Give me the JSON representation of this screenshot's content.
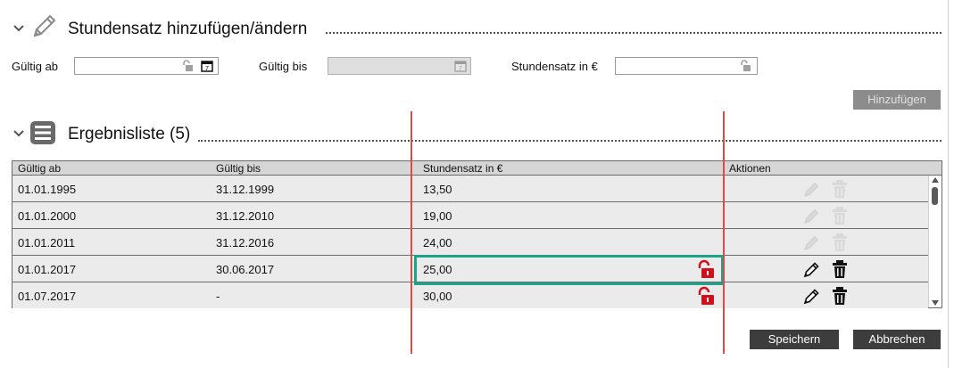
{
  "add_section": {
    "title": "Stundensatz hinzufügen/ändern",
    "fields": {
      "valid_from_label": "Gültig ab",
      "valid_from_value": "",
      "valid_to_label": "Gültig bis",
      "valid_to_value": "",
      "rate_label": "Stundensatz in €",
      "rate_value": ""
    },
    "add_button": "Hinzufügen"
  },
  "results": {
    "title": "Ergebnisliste (5)",
    "columns": [
      "Gültig ab",
      "Gültig bis",
      "Stundensatz in €",
      "Aktionen"
    ],
    "rows": [
      {
        "from": "01.01.1995",
        "to": "31.12.1999",
        "rate": "13,50",
        "actions_enabled": false,
        "unlocked": false
      },
      {
        "from": "01.01.2000",
        "to": "31.12.2010",
        "rate": "19,00",
        "actions_enabled": false,
        "unlocked": false
      },
      {
        "from": "01.01.2011",
        "to": "31.12.2016",
        "rate": "24,00",
        "actions_enabled": false,
        "unlocked": false
      },
      {
        "from": "01.01.2017",
        "to": "30.06.2017",
        "rate": "25,00",
        "actions_enabled": true,
        "unlocked": true,
        "highlighted": true
      },
      {
        "from": "01.07.2017",
        "to": "-",
        "rate": "30,00",
        "actions_enabled": true,
        "unlocked": true
      }
    ]
  },
  "footer": {
    "save_button": "Speichern",
    "cancel_button": "Abbrechen"
  },
  "colors": {
    "button_dark": "#3d3d3d",
    "button_disabled": "#8c8c8c",
    "highlight": "#1aa58a",
    "annotation_line": "#e0474c",
    "unlock_red": "#d0101a"
  }
}
